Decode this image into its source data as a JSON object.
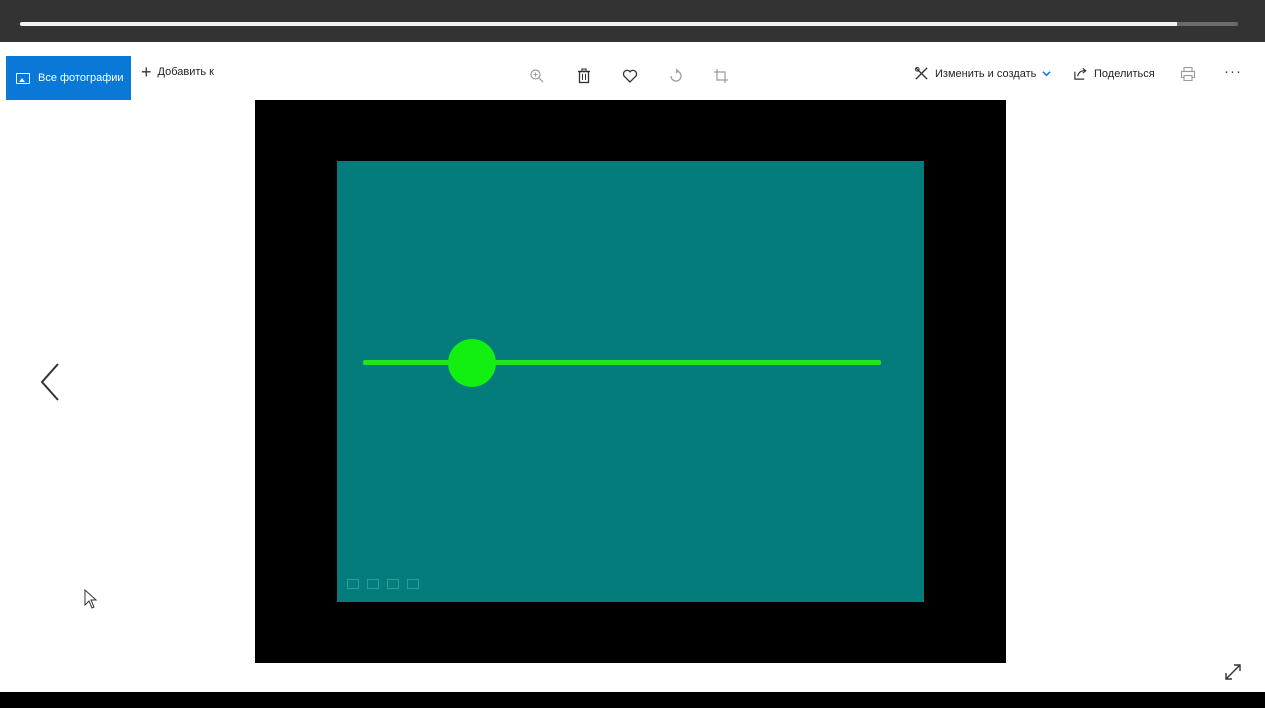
{
  "video": {
    "progress_fraction": 0.95
  },
  "toolbar": {
    "all_photos_label": "Все фотографии",
    "add_to_label": "Добавить к",
    "edit_create_label": "Изменить и создать",
    "share_label": "Поделиться",
    "more_label": "···"
  },
  "photo": {
    "background_color": "#047c7c",
    "slider_color": "#22e61b",
    "knob_color": "#12f011",
    "knob_position_fraction": 0.21
  },
  "colors": {
    "accent": "#0a78d7"
  },
  "icons": [
    "photos-icon",
    "plus-icon",
    "zoom-icon",
    "delete-icon",
    "favorite-icon",
    "rotate-icon",
    "crop-icon",
    "edit-create-icon",
    "chevron-down-icon",
    "share-icon",
    "print-icon",
    "more-icon",
    "chevron-left-icon",
    "cursor-icon",
    "expand-icon"
  ]
}
